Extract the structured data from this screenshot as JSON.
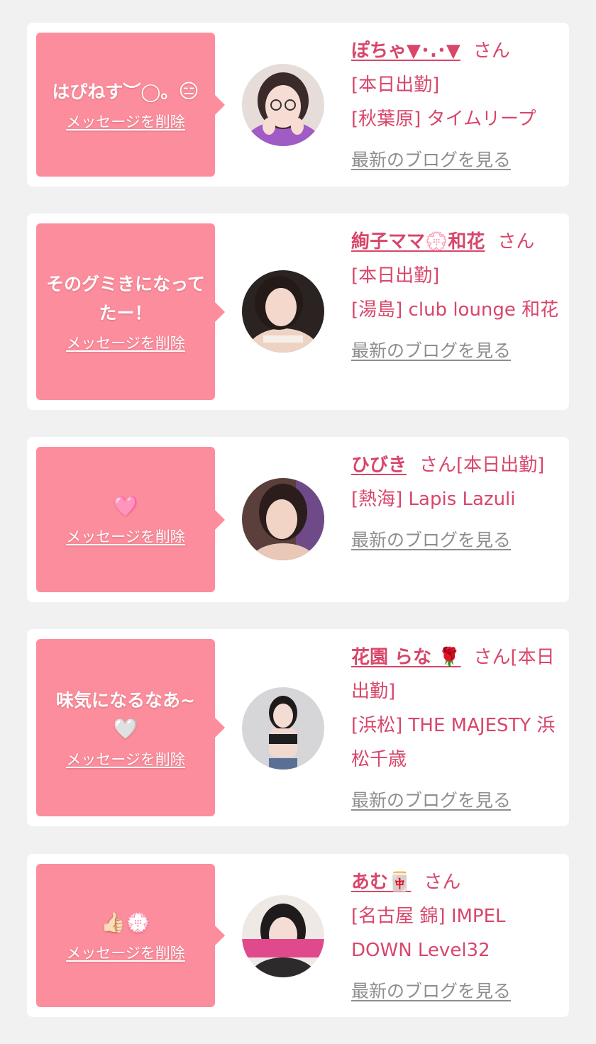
{
  "delete_label": "メッセージを削除",
  "blog_label": "最新のブログを見る",
  "honorific": "さん",
  "colors": {
    "background": "#f1f1f2",
    "bubble": "#fc8d9c",
    "accent_text": "#d8466a",
    "link_gray": "#8e8e8e"
  },
  "cards": [
    {
      "message": "はぴねす︶◯。",
      "message_emoji": "😑",
      "name": "ぽちゃ▼･.･▼",
      "status": "[本日出勤]",
      "shop": "[秋葉原] タイムリープ"
    },
    {
      "message": "そのグミきになってたー！",
      "message_emoji": "",
      "name": "絢子ママ💮和花",
      "status": "[本日出勤]",
      "shop": "[湯島] club lounge 和花"
    },
    {
      "message": "",
      "message_emoji": "🩷",
      "name": "ひびき",
      "status": "[本日出勤]",
      "shop": "[熱海] Lapis Lazuli"
    },
    {
      "message": "味気になるなあ~",
      "message_emoji": "🤍",
      "name": "花園 らな 🌹",
      "status": "[本日出勤]",
      "shop": "[浜松] THE MAJESTY 浜松千歳"
    },
    {
      "message": "",
      "message_emoji": "👍🏻💮",
      "name": "あむ🀄",
      "status": "",
      "shop": "[名古屋 錦] IMPEL DOWN Level32"
    }
  ]
}
